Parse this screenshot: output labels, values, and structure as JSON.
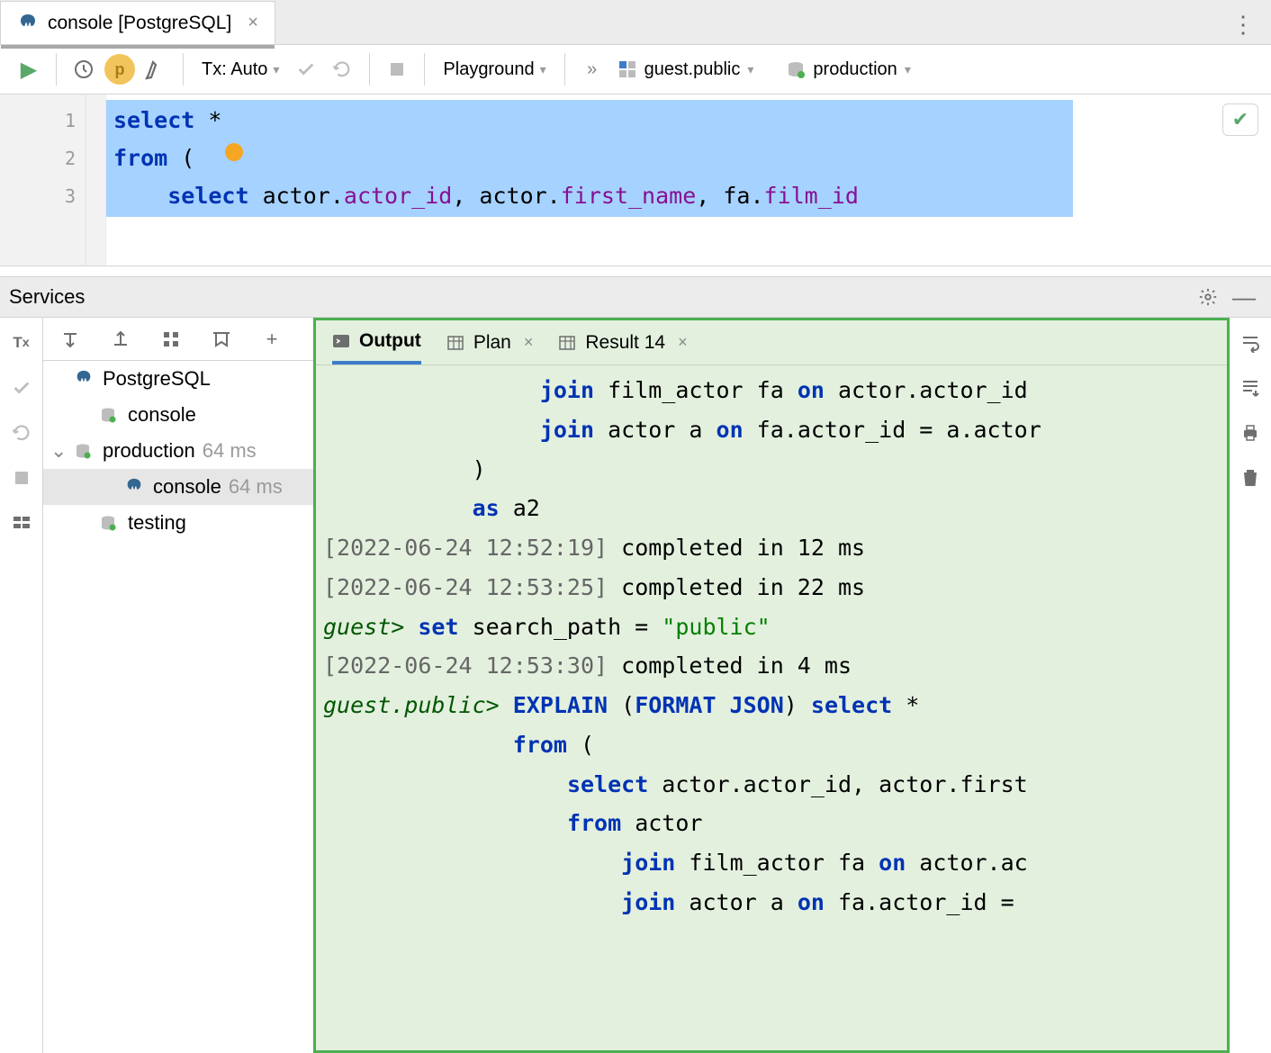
{
  "tab": {
    "title": "console [PostgreSQL]"
  },
  "toolbar": {
    "tx_label": "Tx: Auto",
    "playground_label": "Playground",
    "schema": "guest.public",
    "datasource": "production"
  },
  "editor": {
    "lines": [
      "1",
      "2",
      "3"
    ],
    "code": [
      {
        "pre": "",
        "tokens": [
          {
            "t": "select",
            "c": "kw"
          },
          {
            "t": " *",
            "c": ""
          }
        ]
      },
      {
        "pre": "",
        "tokens": [
          {
            "t": "from",
            "c": "kw"
          },
          {
            "t": " (",
            "c": ""
          }
        ]
      },
      {
        "pre": "    ",
        "tokens": [
          {
            "t": "select",
            "c": "kw"
          },
          {
            "t": " actor.",
            "c": ""
          },
          {
            "t": "actor_id",
            "c": "field"
          },
          {
            "t": ", actor.",
            "c": ""
          },
          {
            "t": "first_name",
            "c": "field"
          },
          {
            "t": ", fa.",
            "c": ""
          },
          {
            "t": "film_id",
            "c": "field"
          }
        ]
      }
    ]
  },
  "services": {
    "title": "Services",
    "tree": [
      {
        "level": 0,
        "twisty": "",
        "icon": "pg",
        "label": "PostgreSQL",
        "ms": ""
      },
      {
        "level": 1,
        "twisty": "",
        "icon": "ds",
        "label": "console",
        "ms": ""
      },
      {
        "level": 0,
        "twisty": "v",
        "icon": "ds",
        "label": "production",
        "ms": "64 ms"
      },
      {
        "level": 2,
        "twisty": "",
        "icon": "pg",
        "label": "console",
        "ms": "64 ms",
        "selected": true
      },
      {
        "level": 1,
        "twisty": "",
        "icon": "ds",
        "label": "testing",
        "ms": ""
      }
    ]
  },
  "output_tabs": {
    "output": "Output",
    "plan": "Plan",
    "result": "Result 14"
  },
  "output_lines": [
    {
      "indent": "                ",
      "segs": [
        {
          "t": "join",
          "c": "kw2"
        },
        {
          "t": " film_actor fa ",
          "c": ""
        },
        {
          "t": "on",
          "c": "kw2"
        },
        {
          "t": " actor.actor_id",
          "c": ""
        }
      ]
    },
    {
      "indent": "                ",
      "segs": [
        {
          "t": "join",
          "c": "kw2"
        },
        {
          "t": " actor a ",
          "c": ""
        },
        {
          "t": "on",
          "c": "kw2"
        },
        {
          "t": " fa.actor_id = a.actor",
          "c": ""
        }
      ]
    },
    {
      "indent": "           ",
      "segs": [
        {
          "t": ")",
          "c": ""
        }
      ]
    },
    {
      "indent": "           ",
      "segs": [
        {
          "t": "as",
          "c": "kw2"
        },
        {
          "t": " a2",
          "c": ""
        }
      ]
    },
    {
      "indent": "",
      "segs": [
        {
          "t": "[2022-06-24 12:52:19] ",
          "c": "ts"
        },
        {
          "t": "completed in 12 ms",
          "c": ""
        }
      ]
    },
    {
      "indent": "",
      "segs": [
        {
          "t": "[2022-06-24 12:53:25] ",
          "c": "ts"
        },
        {
          "t": "completed in 22 ms",
          "c": ""
        }
      ]
    },
    {
      "indent": "",
      "segs": [
        {
          "t": "guest> ",
          "c": "pr"
        },
        {
          "t": "set",
          "c": "kw2"
        },
        {
          "t": " search_path = ",
          "c": ""
        },
        {
          "t": "\"public\"",
          "c": "str"
        }
      ]
    },
    {
      "indent": "",
      "segs": [
        {
          "t": "[2022-06-24 12:53:30] ",
          "c": "ts"
        },
        {
          "t": "completed in 4 ms",
          "c": ""
        }
      ]
    },
    {
      "indent": "",
      "segs": [
        {
          "t": "guest.public> ",
          "c": "pr"
        },
        {
          "t": "EXPLAIN ",
          "c": "kw2"
        },
        {
          "t": "(",
          "c": ""
        },
        {
          "t": "FORMAT JSON",
          "c": "kw2"
        },
        {
          "t": ") ",
          "c": ""
        },
        {
          "t": "select",
          "c": "kw2"
        },
        {
          "t": " *",
          "c": ""
        }
      ]
    },
    {
      "indent": "              ",
      "segs": [
        {
          "t": "from",
          "c": "kw2"
        },
        {
          "t": " (",
          "c": ""
        }
      ]
    },
    {
      "indent": "                  ",
      "segs": [
        {
          "t": "select",
          "c": "kw2"
        },
        {
          "t": " actor.actor_id, actor.first",
          "c": ""
        }
      ]
    },
    {
      "indent": "                  ",
      "segs": [
        {
          "t": "from",
          "c": "kw2"
        },
        {
          "t": " actor",
          "c": ""
        }
      ]
    },
    {
      "indent": "                      ",
      "segs": [
        {
          "t": "join",
          "c": "kw2"
        },
        {
          "t": " film_actor fa ",
          "c": ""
        },
        {
          "t": "on",
          "c": "kw2"
        },
        {
          "t": " actor.ac",
          "c": ""
        }
      ]
    },
    {
      "indent": "                      ",
      "segs": [
        {
          "t": "join",
          "c": "kw2"
        },
        {
          "t": " actor a ",
          "c": ""
        },
        {
          "t": "on",
          "c": "kw2"
        },
        {
          "t": " fa.actor_id =",
          "c": ""
        }
      ]
    }
  ]
}
